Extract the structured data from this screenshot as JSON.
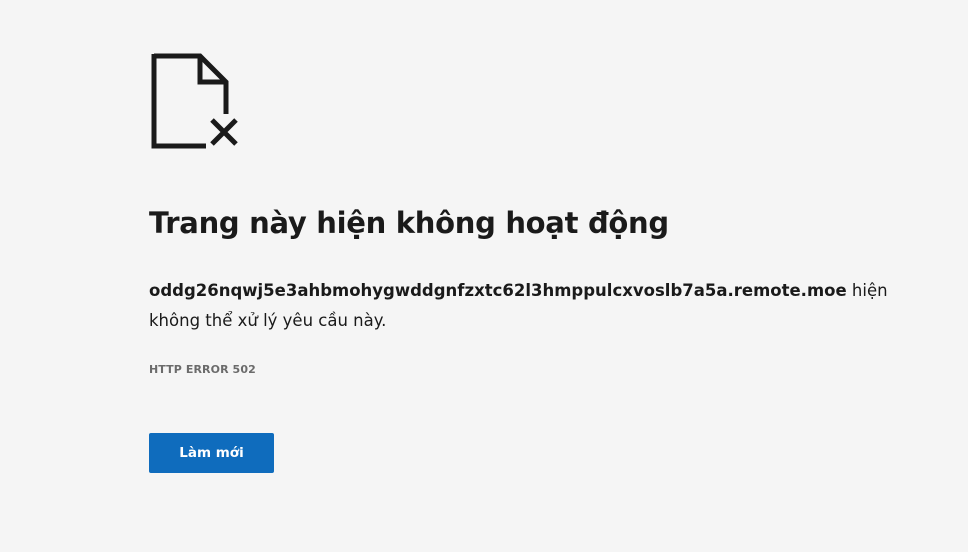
{
  "error_page": {
    "icon": "broken-document-icon",
    "title": "Trang này hiện không hoạt động",
    "host": "oddg26nqwj5e3ahbmohygwddgnfzxtc62l3hmppulcxvoslb7a5a.remote.moe",
    "message_suffix": " hiện không thể xử lý yêu cầu này.",
    "error_code": "HTTP ERROR 502",
    "reload_label": "Làm mới"
  },
  "colors": {
    "background": "#f5f5f5",
    "text": "#1a1a1a",
    "muted": "#6b6b6b",
    "button": "#0f6cbd",
    "button_text": "#ffffff"
  }
}
